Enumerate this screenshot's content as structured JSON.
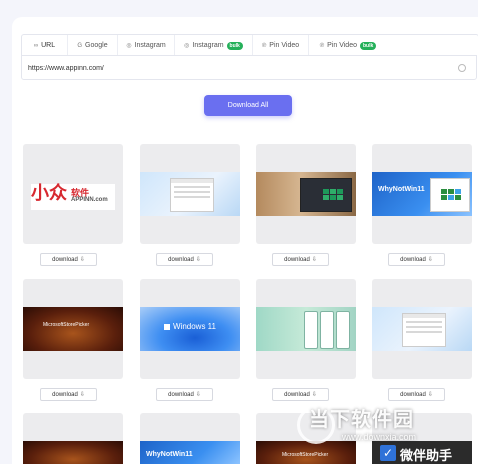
{
  "tabs": [
    {
      "label": "URL",
      "icon": "link-icon",
      "badge": ""
    },
    {
      "label": "Google",
      "icon": "google-icon",
      "badge": ""
    },
    {
      "label": "Instagram",
      "icon": "instagram-icon",
      "badge": ""
    },
    {
      "label": "Instagram",
      "icon": "instagram-icon",
      "badge": "bulk"
    },
    {
      "label": "Pin Video",
      "icon": "pinterest-icon",
      "badge": ""
    },
    {
      "label": "Pin Video",
      "icon": "pinterest-icon",
      "badge": "bulk"
    }
  ],
  "url_input": {
    "value": "https://www.appinn.com/"
  },
  "download_all_label": "Download All",
  "card_button_label": "download",
  "thumb1": {
    "logo_mark": "小众",
    "logo_cn": "软件",
    "logo_en": "APPINN.com"
  },
  "thumb_text": {
    "whynotwin": "WhyNotWin11",
    "mspicker": "MicrosoftStorePicker",
    "win11": "Windows 11"
  },
  "watermark": {
    "title": "当下软件园",
    "url": "www.downxia.com",
    "overlay": "微伴助手"
  },
  "colors": {
    "accent": "#6a6ff0",
    "badge": "#25b05a",
    "card_bg": "#ececee"
  }
}
